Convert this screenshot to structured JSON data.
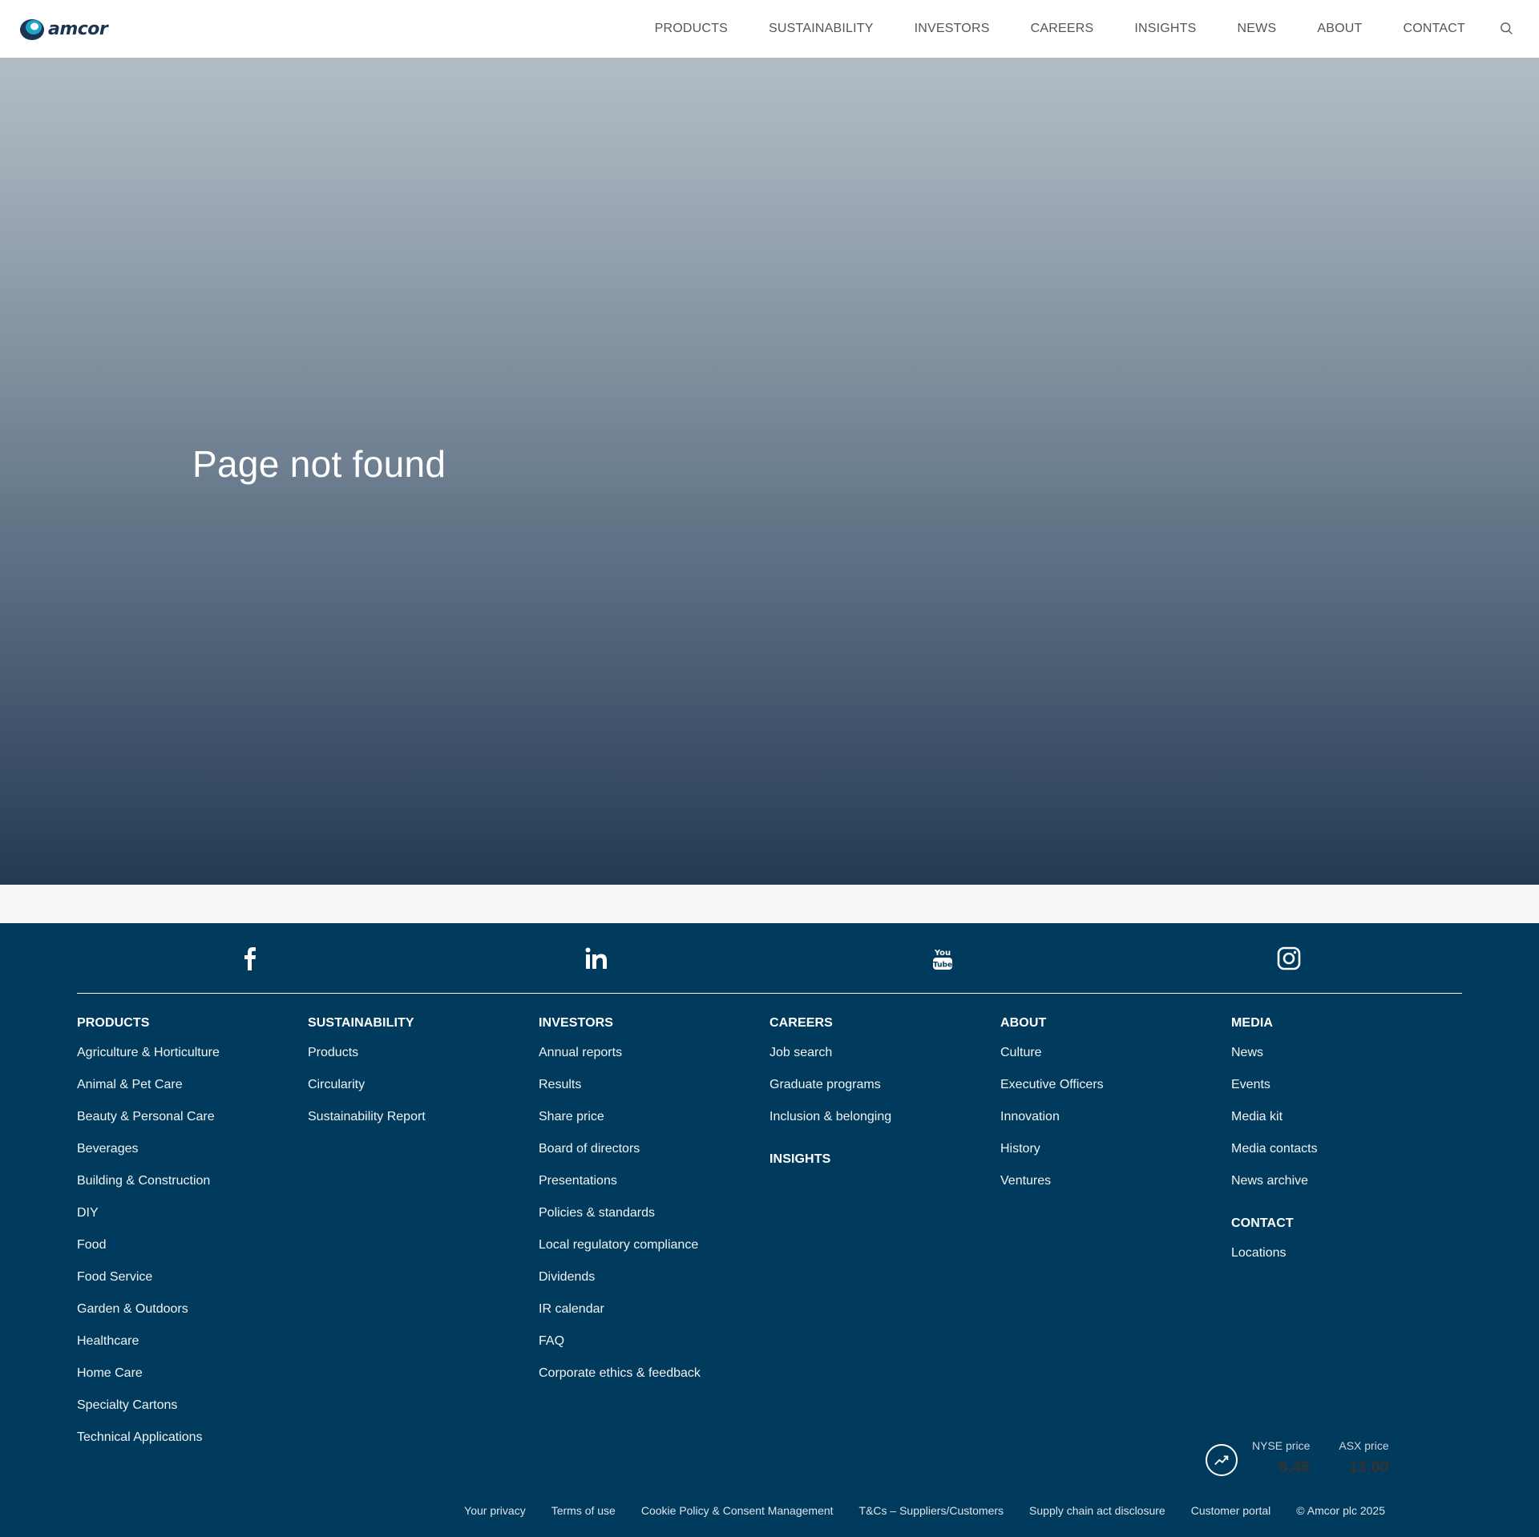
{
  "header": {
    "logo_text": "amcor",
    "nav": [
      "PRODUCTS",
      "SUSTAINABILITY",
      "INVESTORS",
      "CAREERS",
      "INSIGHTS",
      "NEWS",
      "ABOUT",
      "CONTACT"
    ]
  },
  "hero": {
    "title": "Page not found"
  },
  "footer": {
    "social": [
      "facebook-icon",
      "linkedin-icon",
      "youtube-icon",
      "instagram-icon"
    ],
    "columns": [
      {
        "heading": "PRODUCTS",
        "links": [
          "Agriculture & Horticulture",
          "Animal & Pet Care",
          "Beauty & Personal Care",
          "Beverages",
          "Building & Construction",
          "DIY",
          "Food",
          "Food Service",
          "Garden & Outdoors",
          "Healthcare",
          "Home Care",
          "Specialty Cartons",
          "Technical Applications"
        ]
      },
      {
        "heading": "SUSTAINABILITY",
        "links": [
          "Products",
          "Circularity",
          "Sustainability Report"
        ]
      },
      {
        "heading": "INVESTORS",
        "links": [
          "Annual reports",
          "Results",
          "Share price",
          "Board of directors",
          "Presentations",
          "Policies & standards",
          "Local regulatory compliance",
          "Dividends",
          "IR calendar",
          "FAQ",
          "Corporate ethics & feedback"
        ]
      },
      {
        "heading": "CAREERS",
        "links": [
          "Job search",
          "Graduate programs",
          "Inclusion & belonging"
        ],
        "sub_heading": "INSIGHTS"
      },
      {
        "heading": "ABOUT",
        "links": [
          "Culture",
          "Executive Officers",
          "Innovation",
          "History",
          "Ventures"
        ]
      },
      {
        "heading": "MEDIA",
        "links": [
          "News",
          "Events",
          "Media kit",
          "Media contacts",
          "News archive"
        ],
        "sub_heading": "CONTACT",
        "sub_links": [
          "Locations"
        ]
      }
    ],
    "stock": {
      "nyse_label": "NYSE price",
      "nyse_value": "8.46",
      "asx_label": "ASX price",
      "asx_value": "13.00"
    },
    "legal": [
      "Your privacy",
      "Terms of use",
      "Cookie Policy & Consent Management",
      "T&Cs – Suppliers/Customers",
      "Supply chain act disclosure",
      "Customer portal",
      "© Amcor plc 2025"
    ]
  }
}
